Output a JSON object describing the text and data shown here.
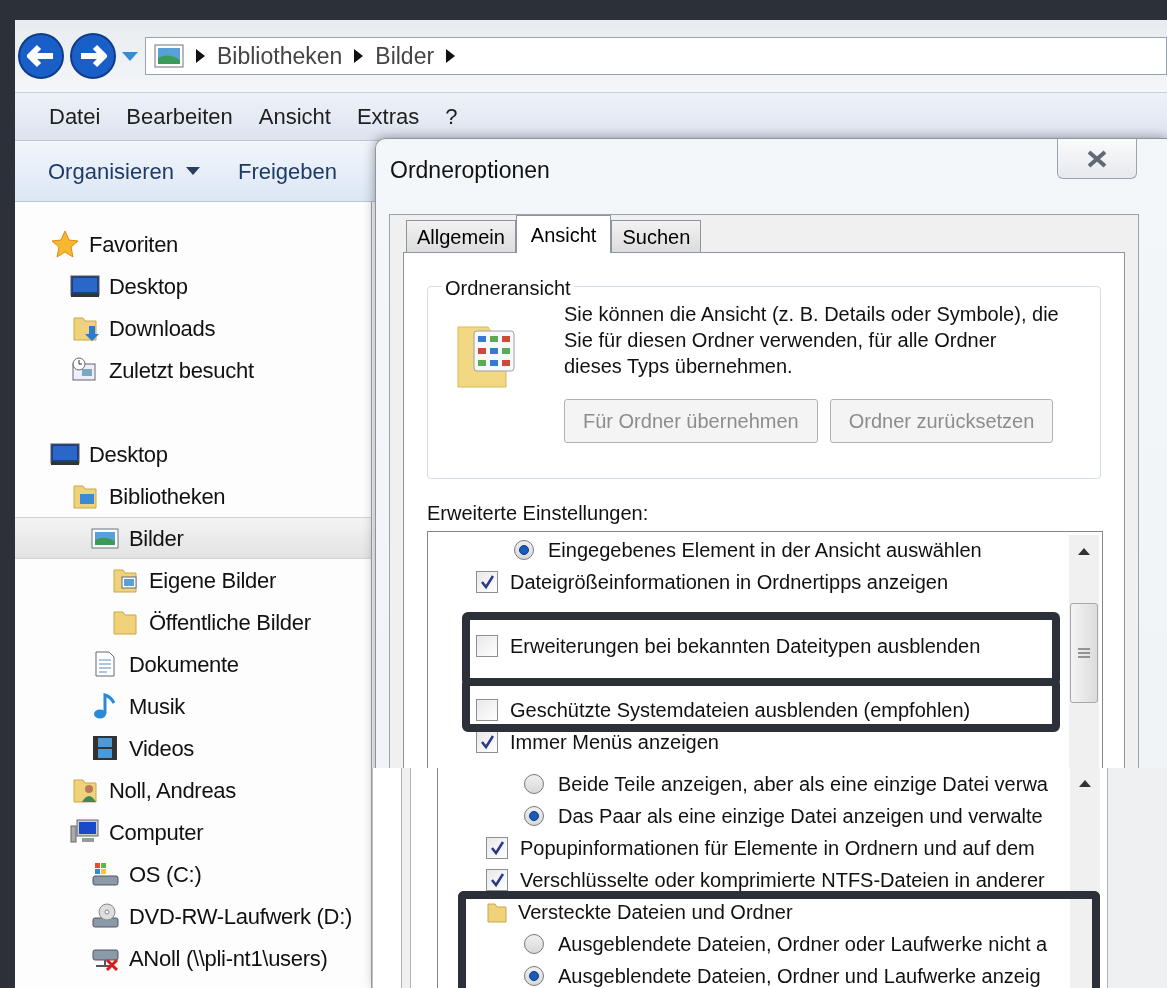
{
  "explorer": {
    "address": {
      "segments": [
        "Bibliotheken",
        "Bilder"
      ]
    },
    "menu": [
      "Datei",
      "Bearbeiten",
      "Ansicht",
      "Extras",
      "?"
    ],
    "toolbar": [
      {
        "label": "Organisieren",
        "dropdown": true
      },
      {
        "label": "Freigeben",
        "dropdown": false
      }
    ],
    "sidebar": {
      "items": [
        {
          "label": "Favoriten",
          "kind": "star",
          "selected": false,
          "children": [
            {
              "label": "Desktop",
              "kind": "desktop",
              "selected": false
            },
            {
              "label": "Downloads",
              "kind": "downloads",
              "selected": false
            },
            {
              "label": "Zuletzt besucht",
              "kind": "recent",
              "selected": false
            }
          ]
        },
        {
          "label": "Desktop",
          "kind": "desktop",
          "selected": false,
          "children": [
            {
              "label": "Bibliotheken",
              "kind": "library",
              "selected": false,
              "children": [
                {
                  "label": "Bilder",
                  "kind": "pictures",
                  "selected": true,
                  "children": [
                    {
                      "label": "Eigene Bilder",
                      "kind": "folder-pictures",
                      "selected": false
                    },
                    {
                      "label": "Öffentliche Bilder",
                      "kind": "folder",
                      "selected": false
                    }
                  ]
                },
                {
                  "label": "Dokumente",
                  "kind": "documents",
                  "selected": false
                },
                {
                  "label": "Musik",
                  "kind": "music",
                  "selected": false
                },
                {
                  "label": "Videos",
                  "kind": "videos",
                  "selected": false
                }
              ]
            },
            {
              "label": "Noll, Andreas",
              "kind": "user-folder",
              "selected": false
            },
            {
              "label": "Computer",
              "kind": "computer",
              "selected": false,
              "children": [
                {
                  "label": "OS (C:)",
                  "kind": "drive-os",
                  "selected": false
                },
                {
                  "label": "DVD-RW-Laufwerk (D:)",
                  "kind": "drive-dvd",
                  "selected": false
                },
                {
                  "label": "ANoll (\\\\pli-nt1\\users)",
                  "kind": "drive-network",
                  "selected": false
                }
              ]
            }
          ]
        }
      ]
    }
  },
  "dialog": {
    "title": "Ordneroptionen",
    "tabs": [
      {
        "label": "Allgemein",
        "selected": false
      },
      {
        "label": "Ansicht",
        "selected": true
      },
      {
        "label": "Suchen",
        "selected": false
      }
    ],
    "folder_view": {
      "title": "Ordneransicht",
      "text": "Sie können die Ansicht (z. B. Details oder Symbole), die Sie für diesen Ordner verwenden, für alle Ordner dieses Typs übernehmen.",
      "buttons": [
        {
          "label": "Für Ordner übernehmen",
          "disabled": true
        },
        {
          "label": "Ordner zurücksetzen",
          "disabled": true
        }
      ]
    },
    "advanced_label": "Erweiterte Einstellungen:",
    "settings": [
      {
        "kind": "radio",
        "label": "Eingegebenes Element in der Ansicht auswählen",
        "checked": true
      },
      {
        "kind": "checkbox",
        "label": "Dateigrößeinformationen in Ordnertipps anzeigen",
        "checked": true
      },
      {
        "kind": "covered"
      },
      {
        "kind": "checkbox",
        "label": "Erweiterungen bei bekannten Dateitypen ausblenden",
        "checked": false
      },
      {
        "kind": "covered"
      },
      {
        "kind": "checkbox",
        "label": "Geschützte Systemdateien ausblenden (empfohlen)",
        "checked": false
      },
      {
        "kind": "checkbox",
        "label": "Immer Menüs anzeigen",
        "checked": true
      }
    ]
  },
  "inset": {
    "settings": [
      {
        "kind": "radio",
        "label": "Beide Teile anzeigen, aber als eine einzige Datei verwa",
        "checked": false
      },
      {
        "kind": "radio",
        "label": "Das Paar als eine einzige Datei anzeigen und verwalte",
        "checked": true
      },
      {
        "kind": "checkbox",
        "label": "Popupinformationen für Elemente in Ordnern und auf dem",
        "checked": true
      },
      {
        "kind": "checkbox",
        "label": "Verschlüsselte oder komprimierte NTFS-Dateien in anderer",
        "checked": true
      },
      {
        "kind": "folder",
        "label": "Versteckte Dateien und Ordner"
      },
      {
        "kind": "radio",
        "label": "Ausgeblendete Dateien, Ordner oder Laufwerke nicht a",
        "checked": false
      },
      {
        "kind": "radio",
        "label": "Ausgeblendete Dateien, Ordner und Laufwerke anzeig",
        "checked": true
      }
    ]
  }
}
